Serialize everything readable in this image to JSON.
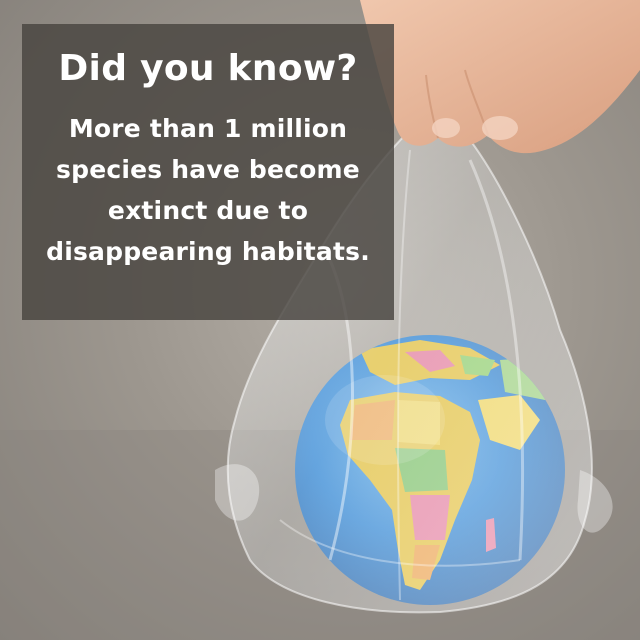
{
  "caption": {
    "headline": "Did you know?",
    "body_lines": [
      "More than 1 million",
      "species have become",
      "extinct due to",
      "disappearing habitats."
    ]
  },
  "colors": {
    "background": "#9d978f",
    "caption_box": "#48443f",
    "caption_text": "#ffffff",
    "ocean": "#2f86d6",
    "land": "#e6c23c",
    "skin": "#e7b79a"
  },
  "photo": {
    "subject": "globe-in-plastic-bag-icon",
    "hand": "hand-icon"
  }
}
